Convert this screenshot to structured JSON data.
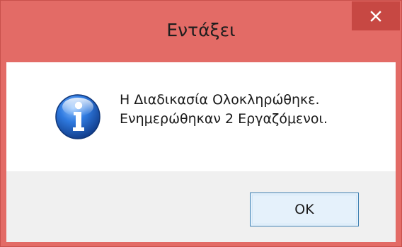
{
  "window": {
    "title": "Εντάξει",
    "close_icon": "close-icon"
  },
  "message": {
    "icon": "info-icon",
    "line1": "Η Διαδικασία Ολοκληρώθηκε.",
    "line2": "Ενημερώθηκαν 2 Εργαζόμενοι."
  },
  "buttons": {
    "ok_label": "OK"
  },
  "colors": {
    "title_bar": "#e36b66",
    "close_button": "#c74843",
    "button_bar": "#f0f0f0",
    "ok_border": "#3c7fb1",
    "info_blue": "#1f5fb8"
  }
}
